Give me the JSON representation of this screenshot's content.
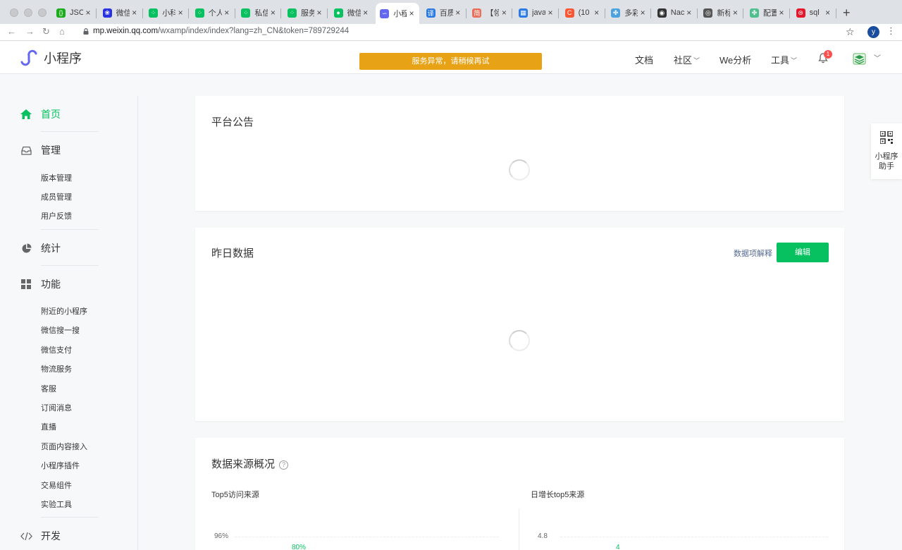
{
  "browser": {
    "tabs": [
      {
        "label": "JSO",
        "icon": "json-icon",
        "color": "#1aad19"
      },
      {
        "label": "微信",
        "icon": "baidu-paw-icon",
        "color": "#2932e1"
      },
      {
        "label": "小科",
        "icon": "dots-grid-icon",
        "color": "#07c160"
      },
      {
        "label": "个人",
        "icon": "dots-grid-icon",
        "color": "#07c160"
      },
      {
        "label": "私信",
        "icon": "dots-grid-icon",
        "color": "#07c160"
      },
      {
        "label": "服务",
        "icon": "dots-grid-icon",
        "color": "#07c160"
      },
      {
        "label": "微信",
        "icon": "wechat-icon",
        "color": "#07c160"
      },
      {
        "label": "小程",
        "icon": "miniprogram-icon",
        "color": "#6467f0"
      },
      {
        "label": "百质",
        "icon": "translate-icon",
        "color": "#2c7be5"
      },
      {
        "label": "【领",
        "icon": "jianshu-icon",
        "color": "#ea6f5a"
      },
      {
        "label": "java",
        "icon": "doc-icon",
        "color": "#2c7be5"
      },
      {
        "label": "(10",
        "icon": "csdn-icon",
        "color": "#fc5531"
      },
      {
        "label": "多彩",
        "icon": "leaf-icon",
        "color": "#4aa3df"
      },
      {
        "label": "Nac",
        "icon": "globe-icon",
        "color": "#333333"
      },
      {
        "label": "新标",
        "icon": "chrome-icon",
        "color": "#555555"
      },
      {
        "label": "配置",
        "icon": "leaf-icon",
        "color": "#4fc08d"
      },
      {
        "label": "sql",
        "icon": "weibo-icon",
        "color": "#e6162d"
      }
    ],
    "url_host": "mp.weixin.qq.com",
    "url_rest": "/wxamp/index/index?lang=zh_CN&token=789729244",
    "profile_initial": "y"
  },
  "header": {
    "brand": "小程序",
    "alert": "服务异常，请稍候再试",
    "nav": [
      {
        "label": "文档",
        "has_dropdown": false
      },
      {
        "label": "社区",
        "has_dropdown": true
      },
      {
        "label": "We分析",
        "has_dropdown": false
      },
      {
        "label": "工具",
        "has_dropdown": true
      }
    ],
    "notification_count": "1"
  },
  "sidebar": {
    "home": "首页",
    "manage": {
      "title": "管理",
      "items": [
        "版本管理",
        "成员管理",
        "用户反馈"
      ]
    },
    "stats": "统计",
    "features": {
      "title": "功能",
      "items": [
        "附近的小程序",
        "微信搜一搜",
        "微信支付",
        "物流服务",
        "客服",
        "订阅消息",
        "直播",
        "页面内容接入",
        "小程序插件",
        "交易组件",
        "实验工具"
      ]
    },
    "dev": "开发"
  },
  "helper": {
    "line1": "小程序",
    "line2": "助手"
  },
  "main": {
    "announcement_title": "平台公告",
    "yesterday_title": "昨日数据",
    "explain_link": "数据项解释",
    "edit_button": "编辑",
    "source_title": "数据来源概况",
    "source_help": "?",
    "left_chart": {
      "title": "Top5访问来源",
      "ytick": "96%",
      "label": "80%"
    },
    "right_chart": {
      "title": "日增长top5来源",
      "ytick": "4.8",
      "label": "4"
    }
  }
}
